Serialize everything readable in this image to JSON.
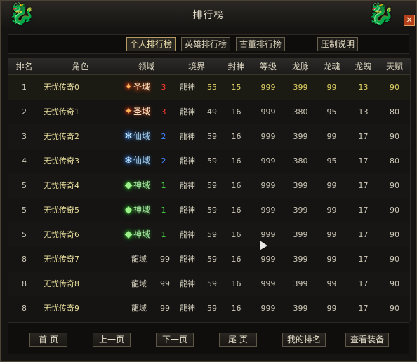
{
  "window": {
    "title": "排行榜",
    "close_label": "×",
    "left_ornament": "dragon-icon",
    "right_ornament": "dragon-icon",
    "colors": {
      "accent": "#b59a61",
      "name": "#e7dd9b",
      "red_level": "#ff3b2e",
      "blue_level": "#3f84ff",
      "green_level": "#47d645"
    }
  },
  "tabs": [
    {
      "label": "个人排行榜",
      "active": true
    },
    {
      "label": "英雄排行榜",
      "active": false
    },
    {
      "label": "古董排行榜",
      "active": false
    }
  ],
  "suppress_label": "压制说明",
  "headers": [
    "排名",
    "角色",
    "领域",
    "境界",
    "封神",
    "等级",
    "龙脉",
    "龙魂",
    "龙魄",
    "天赋"
  ],
  "rows": [
    {
      "rank": "1",
      "name": "无忧传奇0",
      "domain": "圣域",
      "domain_style": "fire",
      "domain_level": "3",
      "realm": "龍神",
      "realm_level": "55",
      "fengshen": "15",
      "level": "999",
      "longmai": "399",
      "longhun": "99",
      "longpo": "13",
      "tianfu": "90"
    },
    {
      "rank": "2",
      "name": "无忧传奇1",
      "domain": "圣域",
      "domain_style": "fire",
      "domain_level": "3",
      "realm": "龍神",
      "realm_level": "49",
      "fengshen": "16",
      "level": "999",
      "longmai": "380",
      "longhun": "95",
      "longpo": "13",
      "tianfu": "80"
    },
    {
      "rank": "3",
      "name": "无忧传奇2",
      "domain": "仙域",
      "domain_style": "ice",
      "domain_level": "2",
      "realm": "龍神",
      "realm_level": "59",
      "fengshen": "16",
      "level": "999",
      "longmai": "399",
      "longhun": "99",
      "longpo": "17",
      "tianfu": "90"
    },
    {
      "rank": "4",
      "name": "无忧传奇3",
      "domain": "仙域",
      "domain_style": "ice",
      "domain_level": "2",
      "realm": "龍神",
      "realm_level": "59",
      "fengshen": "16",
      "level": "999",
      "longmai": "380",
      "longhun": "95",
      "longpo": "17",
      "tianfu": "80"
    },
    {
      "rank": "5",
      "name": "无忧传奇4",
      "domain": "神域",
      "domain_style": "leaf",
      "domain_level": "1",
      "realm": "龍神",
      "realm_level": "59",
      "fengshen": "16",
      "level": "999",
      "longmai": "399",
      "longhun": "99",
      "longpo": "17",
      "tianfu": "90"
    },
    {
      "rank": "5",
      "name": "无忧传奇5",
      "domain": "神域",
      "domain_style": "leaf",
      "domain_level": "1",
      "realm": "龍神",
      "realm_level": "59",
      "fengshen": "16",
      "level": "999",
      "longmai": "399",
      "longhun": "99",
      "longpo": "17",
      "tianfu": "90"
    },
    {
      "rank": "5",
      "name": "无忧传奇6",
      "domain": "神域",
      "domain_style": "leaf",
      "domain_level": "1",
      "realm": "龍神",
      "realm_level": "59",
      "fengshen": "16",
      "level": "999",
      "longmai": "399",
      "longhun": "99",
      "longpo": "17",
      "tianfu": "90"
    },
    {
      "rank": "8",
      "name": "无忧传奇7",
      "domain": "龍域",
      "domain_style": "plain",
      "domain_level": "99",
      "realm": "龍神",
      "realm_level": "59",
      "fengshen": "16",
      "level": "999",
      "longmai": "399",
      "longhun": "99",
      "longpo": "17",
      "tianfu": "90"
    },
    {
      "rank": "8",
      "name": "无忧传奇8",
      "domain": "龍域",
      "domain_style": "plain",
      "domain_level": "99",
      "realm": "龍神",
      "realm_level": "59",
      "fengshen": "16",
      "level": "999",
      "longmai": "399",
      "longhun": "99",
      "longpo": "17",
      "tianfu": "90"
    },
    {
      "rank": "8",
      "name": "无忧传奇9",
      "domain": "龍域",
      "domain_style": "plain",
      "domain_level": "99",
      "realm": "龍神",
      "realm_level": "59",
      "fengshen": "16",
      "level": "999",
      "longmai": "399",
      "longhun": "99",
      "longpo": "17",
      "tianfu": "90"
    }
  ],
  "footer": {
    "first": "首 页",
    "prev": "上一页",
    "next": "下一页",
    "last": "尾 页",
    "my_rank": "我的排名",
    "view_gear": "查看装备"
  }
}
